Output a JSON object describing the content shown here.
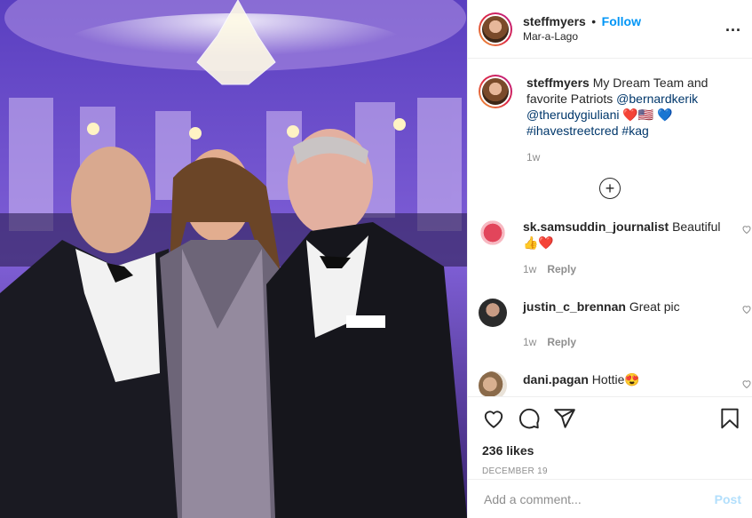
{
  "header": {
    "username": "steffmyers",
    "separator": "•",
    "follow_label": "Follow",
    "location": "Mar-a-Lago",
    "more_label": "..."
  },
  "caption": {
    "username": "steffmyers",
    "text_before": "My Dream Team and favorite Patriots",
    "mention1": "@bernardkerik",
    "mention2": "@therudygiuliani",
    "emoji1": "❤️🇺🇸",
    "emoji2": "💙",
    "hashtag1": "#ihavestreetcred",
    "hashtag2": "#kag",
    "time": "1w"
  },
  "load_more_label": "+",
  "comments": [
    {
      "username": "sk.samsuddin_journalist",
      "text": "Beautiful 👍❤️",
      "time": "1w",
      "reply": "Reply"
    },
    {
      "username": "justin_c_brennan",
      "text": "Great pic",
      "time": "1w",
      "reply": "Reply"
    },
    {
      "username": "dani.pagan",
      "text": "Hottie😍",
      "time": "",
      "reply": ""
    }
  ],
  "likes": "236 likes",
  "date": "DECEMBER 19",
  "add_comment": {
    "placeholder": "Add a comment...",
    "post_label": "Post"
  },
  "colors": {
    "accent": "#0095f6",
    "link": "#00376b",
    "muted": "#8e8e8e",
    "post_disabled": "#b2dffc",
    "heart": "#ed4956"
  },
  "icons": [
    "heart-icon",
    "comment-icon",
    "share-icon",
    "bookmark-icon",
    "plus-circle-icon",
    "more-icon"
  ]
}
